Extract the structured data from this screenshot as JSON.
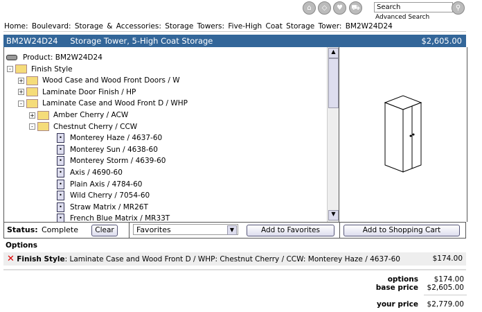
{
  "header": {
    "icons": [
      "home-icon",
      "tag-icon",
      "heart-icon",
      "cart-icon"
    ],
    "search_value": "Search",
    "advanced_search": "Advanced Search"
  },
  "breadcrumb": "Home:  Boulevard:  Storage & Accessories:  Storage Towers:  Five-High Coat Storage Tower:  BM2W24D24",
  "product_bar": {
    "sku": "BM2W24D24",
    "name": "Storage Tower, 5-High Coat Storage",
    "price": "$2,605.00"
  },
  "tree": [
    {
      "label": "Product: BM2W24D24",
      "level": 0,
      "type": "product"
    },
    {
      "label": "Finish Style",
      "level": 0,
      "type": "open-check",
      "toggle": "-"
    },
    {
      "label": "Wood Case and Wood Front Doors / W",
      "level": 1,
      "type": "folder",
      "toggle": "+"
    },
    {
      "label": "Laminate Door Finish / HP",
      "level": 1,
      "type": "folder",
      "toggle": "+"
    },
    {
      "label": "Laminate Case and Wood Front D / WHP",
      "level": 1,
      "type": "folder",
      "toggle": "-"
    },
    {
      "label": "Amber Cherry / ACW",
      "level": 2,
      "type": "folder",
      "toggle": "+"
    },
    {
      "label": "Chestnut Cherry / CCW",
      "level": 2,
      "type": "folder",
      "toggle": "-"
    },
    {
      "label": "Monterey Haze / 4637-60",
      "level": 3,
      "type": "doc"
    },
    {
      "label": "Monterey Sun / 4638-60",
      "level": 3,
      "type": "doc"
    },
    {
      "label": "Monterey Storm / 4639-60",
      "level": 3,
      "type": "doc"
    },
    {
      "label": "Axis / 4690-60",
      "level": 3,
      "type": "doc"
    },
    {
      "label": "Plain Axis / 4784-60",
      "level": 3,
      "type": "doc"
    },
    {
      "label": "Wild Cherry / 7054-60",
      "level": 3,
      "type": "doc"
    },
    {
      "label": "Straw Matrix / MR26T",
      "level": 3,
      "type": "doc"
    },
    {
      "label": "French Blue Matrix / MR33T",
      "level": 3,
      "type": "doc"
    }
  ],
  "toolbar": {
    "status_label": "Status:",
    "status_value": "Complete",
    "clear": "Clear",
    "favorites_select": "Favorites",
    "add_favorites": "Add to Favorites",
    "add_cart": "Add to Shopping Cart"
  },
  "options": {
    "heading": "Options",
    "items": [
      {
        "name": "Finish Style",
        "desc": ": Laminate Case and Wood Front D / WHP: Chestnut Cherry / CCW: Monterey Haze / 4637-60",
        "price": "$174.00"
      }
    ]
  },
  "totals": {
    "options_label": "options",
    "options_value": "$174.00",
    "base_label": "base price",
    "base_value": "$2,605.00",
    "your_label": "your price",
    "your_value": "$2,779.00"
  },
  "colors": {
    "bar": "#336699"
  }
}
